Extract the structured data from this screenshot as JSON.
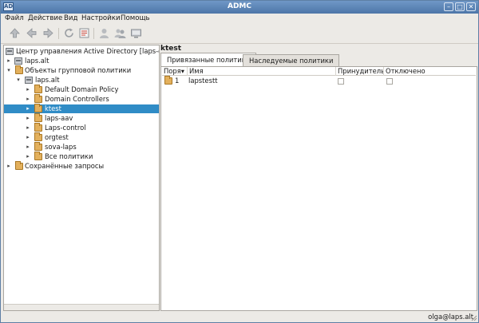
{
  "window": {
    "title": "ADMC",
    "app_icon_text": "AD",
    "controls": [
      "minimize",
      "maximize",
      "close"
    ]
  },
  "menu": {
    "items": [
      {
        "label": "Файл"
      },
      {
        "label": "Действие"
      },
      {
        "label": "Вид"
      },
      {
        "label": "Настройки"
      },
      {
        "label": "Помощь"
      }
    ]
  },
  "toolbar": {
    "buttons": [
      {
        "icon": "up-arrow-icon"
      },
      {
        "icon": "back-arrow-icon"
      },
      {
        "icon": "forward-arrow-icon"
      },
      {
        "icon": "refresh-icon"
      },
      {
        "icon": "properties-icon"
      },
      {
        "icon": "user-icon"
      },
      {
        "icon": "users-icon"
      },
      {
        "icon": "computer-icon"
      }
    ]
  },
  "tree": {
    "nodes": [
      {
        "label": "Центр управления Active Directory [laps-dc.laps.alt",
        "icon": "domain-icon",
        "arrow": ""
      },
      {
        "label": "laps.alt",
        "icon": "domain-icon",
        "arrow": "▸"
      },
      {
        "label": "Объекты групповой политики",
        "icon": "folder-icon",
        "arrow": "▾"
      },
      {
        "label": "laps.alt",
        "icon": "domain-icon",
        "arrow": "▾"
      },
      {
        "label": "Default Domain Policy",
        "icon": "gpo-icon",
        "arrow": "▸"
      },
      {
        "label": "Domain Controllers",
        "icon": "folder-icon",
        "arrow": "▸"
      },
      {
        "label": "ktest",
        "icon": "folder-icon",
        "arrow": "▸",
        "selected": true
      },
      {
        "label": "laps-aav",
        "icon": "folder-icon",
        "arrow": "▸"
      },
      {
        "label": "Laps-control",
        "icon": "folder-icon",
        "arrow": "▸"
      },
      {
        "label": "orgtest",
        "icon": "folder-icon",
        "arrow": "▸"
      },
      {
        "label": "sova-laps",
        "icon": "folder-icon",
        "arrow": "▸"
      },
      {
        "label": "Все политики",
        "icon": "folder-icon",
        "arrow": "▸"
      },
      {
        "label": "Сохранённые запросы",
        "icon": "folder-icon",
        "arrow": "▸"
      }
    ]
  },
  "details": {
    "heading": "ktest",
    "tabs": [
      {
        "label": "Привязанные политики",
        "active": true
      },
      {
        "label": "Наследуемые политики",
        "active": false
      }
    ],
    "columns": [
      "Поря",
      "Имя",
      "Принудительно",
      "Отключено"
    ],
    "sort_indicator": "▾",
    "rows": [
      {
        "order": "1",
        "name": "lapstestt",
        "enforced": false,
        "disabled": false
      }
    ]
  },
  "status": {
    "user": "olga@laps.alt"
  },
  "colors": {
    "title_bar": "#5c85b8",
    "selection": "#308cc6",
    "window_bg": "#eceae6"
  }
}
